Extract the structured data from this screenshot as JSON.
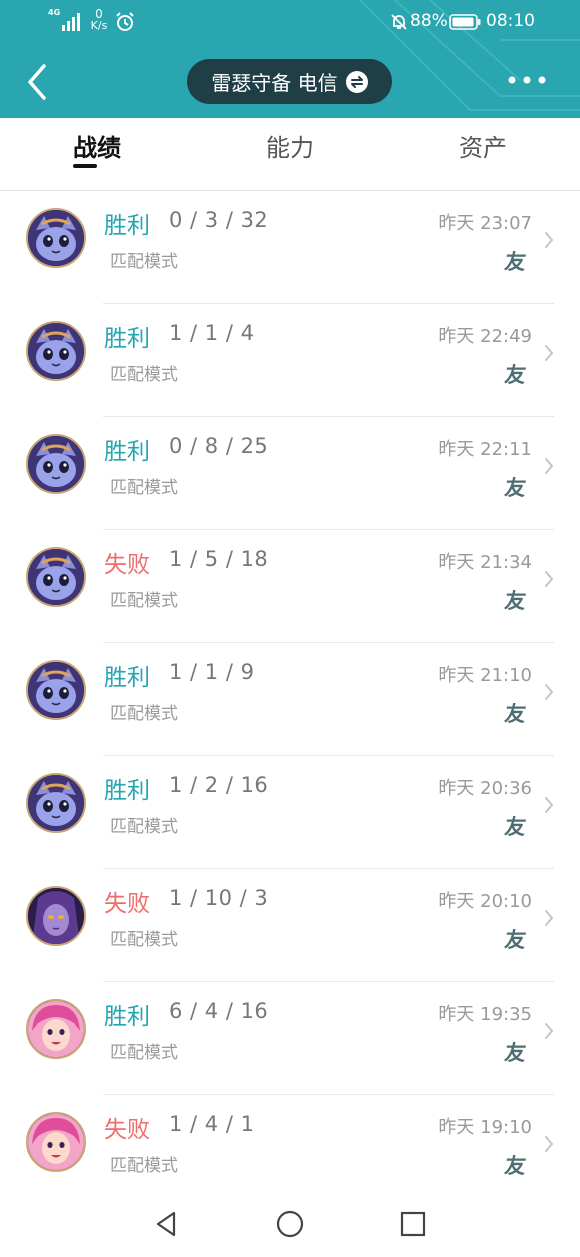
{
  "status_bar": {
    "network": "4G",
    "speed_value": "0",
    "speed_unit": "K/s",
    "battery": "88%",
    "time": "08:10"
  },
  "header": {
    "account_label": "雷瑟守备 电信",
    "back_icon": "chevron-left-icon",
    "more_icon": "more-dots-icon",
    "accent_color": "#29a6b0"
  },
  "tabs": [
    {
      "label": "战绩",
      "active": true
    },
    {
      "label": "能力",
      "active": false
    },
    {
      "label": "资产",
      "active": false
    }
  ],
  "matches": [
    {
      "result": "胜利",
      "outcome": "win",
      "kda": "0 / 3 / 32",
      "mode": "匹配模式",
      "time": "昨天 23:07",
      "tag": "友",
      "avatar": "purple-cat-champion"
    },
    {
      "result": "胜利",
      "outcome": "win",
      "kda": "1 / 1 / 4",
      "mode": "匹配模式",
      "time": "昨天 22:49",
      "tag": "友",
      "avatar": "purple-cat-champion"
    },
    {
      "result": "胜利",
      "outcome": "win",
      "kda": "0 / 8 / 25",
      "mode": "匹配模式",
      "time": "昨天 22:11",
      "tag": "友",
      "avatar": "purple-cat-champion"
    },
    {
      "result": "失败",
      "outcome": "lose",
      "kda": "1 / 5 / 18",
      "mode": "匹配模式",
      "time": "昨天 21:34",
      "tag": "友",
      "avatar": "purple-cat-champion"
    },
    {
      "result": "胜利",
      "outcome": "win",
      "kda": "1 / 1 / 9",
      "mode": "匹配模式",
      "time": "昨天 21:10",
      "tag": "友",
      "avatar": "purple-cat-champion"
    },
    {
      "result": "胜利",
      "outcome": "win",
      "kda": "1 / 2 / 16",
      "mode": "匹配模式",
      "time": "昨天 20:36",
      "tag": "友",
      "avatar": "purple-cat-champion"
    },
    {
      "result": "失败",
      "outcome": "lose",
      "kda": "1 / 10 / 3",
      "mode": "匹配模式",
      "time": "昨天 20:10",
      "tag": "友",
      "avatar": "violet-mage-champion"
    },
    {
      "result": "胜利",
      "outcome": "win",
      "kda": "6 / 4 / 16",
      "mode": "匹配模式",
      "time": "昨天 19:35",
      "tag": "友",
      "avatar": "pink-hair-champion"
    },
    {
      "result": "失败",
      "outcome": "lose",
      "kda": "1 / 4 / 1",
      "mode": "匹配模式",
      "time": "昨天 19:10",
      "tag": "友",
      "avatar": "pink-hair-champion"
    }
  ],
  "colors": {
    "win": "#24a5b3",
    "lose": "#ee6d6d",
    "pill": "#1f3e46"
  }
}
